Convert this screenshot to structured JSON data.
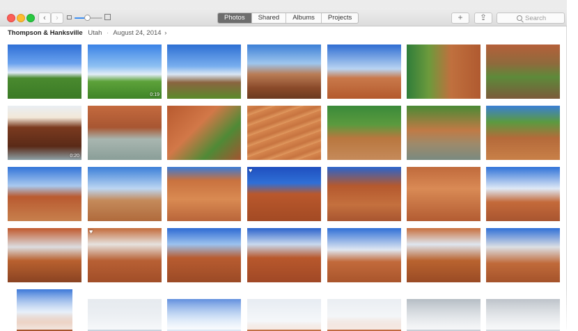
{
  "window": {
    "close_label": "close",
    "minimize_label": "minimize",
    "zoom_label": "zoom"
  },
  "toolbar": {
    "back_glyph": "‹",
    "forward_glyph": "›",
    "zoom_level": 0.45,
    "tabs": [
      {
        "label": "Photos",
        "active": true
      },
      {
        "label": "Shared",
        "active": false
      },
      {
        "label": "Albums",
        "active": false
      },
      {
        "label": "Projects",
        "active": false
      }
    ],
    "add_glyph": "+",
    "share_glyph": "⇪",
    "search_placeholder": "Search"
  },
  "moment": {
    "title": "Thompson & Hanksville",
    "location": "Utah",
    "separator": "·",
    "date": "August 24, 2014",
    "chevron": "›"
  },
  "photos": [
    {
      "scene": "sky-horse",
      "badge": "",
      "favorite": false
    },
    {
      "scene": "sky-horse-bright",
      "badge": "0:19",
      "favorite": false
    },
    {
      "scene": "horse-rider-sky",
      "badge": "",
      "favorite": false
    },
    {
      "scene": "canyon-overlook",
      "badge": "",
      "favorite": false
    },
    {
      "scene": "monument-valley",
      "badge": "",
      "favorite": false
    },
    {
      "scene": "portrait-rock",
      "badge": "",
      "favorite": false
    },
    {
      "scene": "green-canyon",
      "badge": "",
      "favorite": false
    },
    {
      "scene": "waterfall-dark",
      "badge": "0:20",
      "favorite": false
    },
    {
      "scene": "man-waterfall",
      "badge": "",
      "favorite": false
    },
    {
      "scene": "red-canyon-trees",
      "badge": "",
      "favorite": false
    },
    {
      "scene": "sand-ripples",
      "badge": "",
      "favorite": false
    },
    {
      "scene": "river-trees",
      "badge": "",
      "favorite": false
    },
    {
      "scene": "girl-creek",
      "badge": "",
      "favorite": false
    },
    {
      "scene": "creek-trees",
      "badge": "",
      "favorite": false
    },
    {
      "scene": "butte-rider",
      "badge": "",
      "favorite": false
    },
    {
      "scene": "couple-desert",
      "badge": "",
      "favorite": false
    },
    {
      "scene": "dome-rock",
      "badge": "",
      "favorite": false
    },
    {
      "scene": "arch-red",
      "badge": "",
      "favorite": true
    },
    {
      "scene": "arch-person",
      "badge": "",
      "favorite": false
    },
    {
      "scene": "arch-selfie",
      "badge": "",
      "favorite": false
    },
    {
      "scene": "arch-sky",
      "badge": "",
      "favorite": false
    },
    {
      "scene": "girl-arch",
      "badge": "",
      "favorite": false
    },
    {
      "scene": "couple-arch",
      "badge": "",
      "favorite": true
    },
    {
      "scene": "arch-climber",
      "badge": "",
      "favorite": false
    },
    {
      "scene": "arch-window",
      "badge": "",
      "favorite": false
    },
    {
      "scene": "arch-blue",
      "badge": "",
      "favorite": false
    },
    {
      "scene": "man-arch",
      "badge": "",
      "favorite": false
    },
    {
      "scene": "couple-selfie",
      "badge": "",
      "favorite": false
    },
    {
      "scene": "sky-rock-partial",
      "badge": "",
      "favorite": false
    },
    {
      "scene": "clouds-partial",
      "badge": "",
      "favorite": false
    },
    {
      "scene": "blue-sky-partial",
      "badge": "",
      "favorite": false
    },
    {
      "scene": "spires-partial",
      "badge": "",
      "favorite": false
    },
    {
      "scene": "spires-red-partial",
      "badge": "",
      "favorite": false
    },
    {
      "scene": "grey-sky-partial",
      "badge": "",
      "favorite": false
    },
    {
      "scene": "storm-partial",
      "badge": "",
      "favorite": false
    }
  ],
  "colors": {
    "accent": "#3d8ef2",
    "active_tab": "#6d6d6d",
    "close": "#fc5f57",
    "minimize": "#fdbc2e",
    "maximize": "#28c840"
  }
}
